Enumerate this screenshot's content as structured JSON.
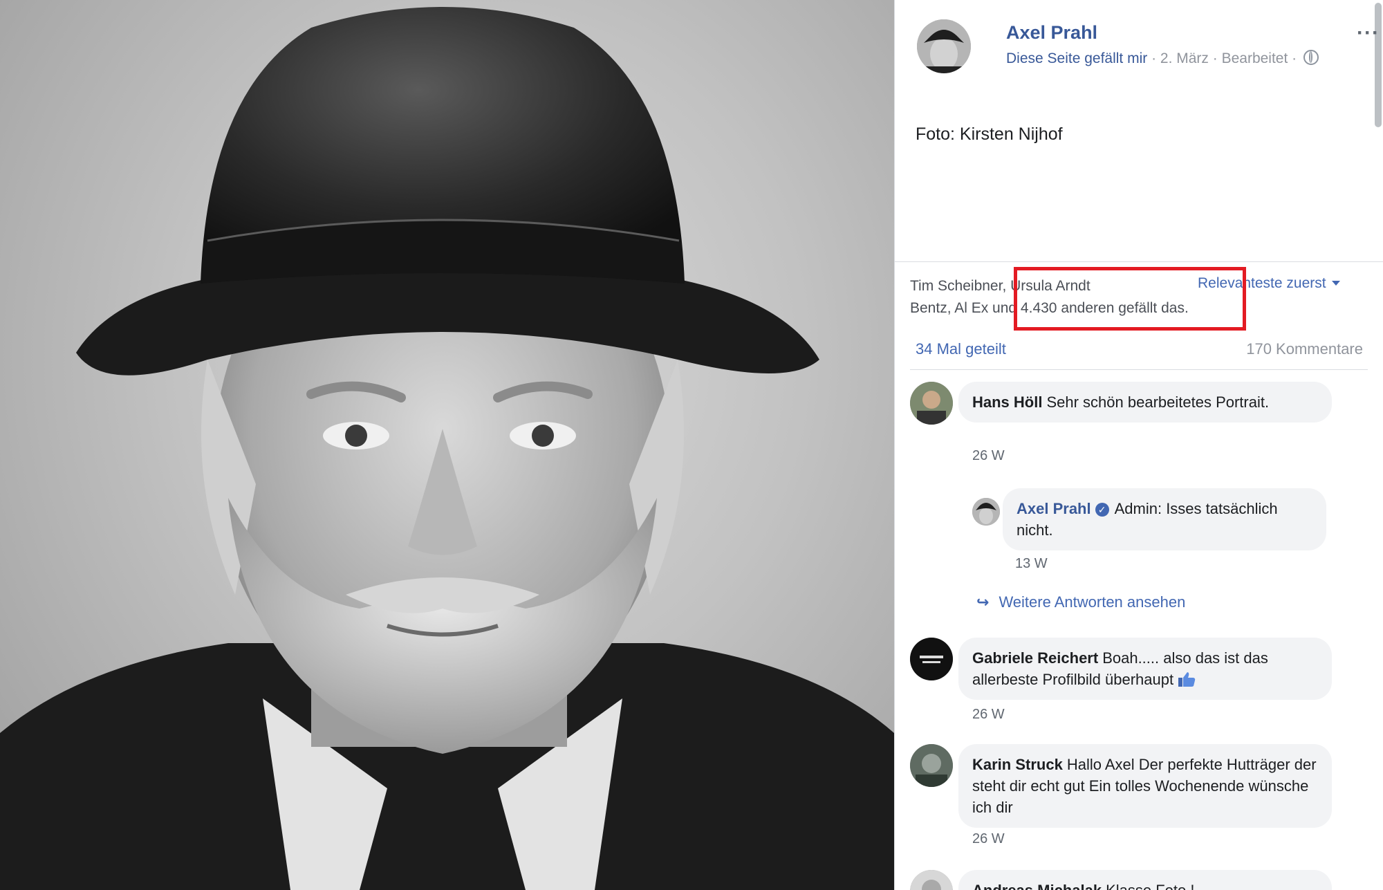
{
  "post": {
    "page_name": "Axel Prahl",
    "like_link": "Diese Seite gefällt mir",
    "meta_rest": " · 2. März · Bearbeitet · ",
    "more": "···",
    "caption": "Foto: Kirsten Nijhof"
  },
  "reactions": {
    "likes_line1": "Tim Scheibner, Ursula Arndt",
    "likes_line2": "Bentz, Al Ex und 4.430 anderen gefällt das.",
    "sort_label": "Relevanteste zuerst",
    "shares": "34 Mal geteilt",
    "comments_count": "170 Kommentare"
  },
  "comments": [
    {
      "author": "Hans Höll",
      "text": "Sehr schön bearbeitetes Portrait.",
      "time": "26 W"
    },
    {
      "author": "Axel Prahl",
      "text": "Admin: Isses tatsächlich nicht.",
      "time": "13 W"
    },
    {
      "author": "Gabriele Reichert",
      "text": "Boah..... also das ist das allerbeste Profilbild überhaupt",
      "time": "26 W"
    },
    {
      "author": "Karin Struck",
      "text": "Hallo Axel Der perfekte Hutträger der steht dir echt gut Ein tolles Wochenende wünsche ich dir",
      "time": "26 W"
    },
    {
      "author": "Andreas Michalak",
      "text": "Klasse Foto !"
    }
  ],
  "more_replies": "Weitere Antworten ansehen",
  "verified_mark": "✓",
  "colors": {
    "link": "#385898",
    "accent": "#4267b2",
    "highlight": "#e31b23",
    "bubble": "#f2f3f5"
  },
  "icons": [
    "globe-icon",
    "more-icon",
    "caret-down-icon",
    "verified-icon",
    "reply-arrow-icon",
    "thumbs-up-icon"
  ]
}
